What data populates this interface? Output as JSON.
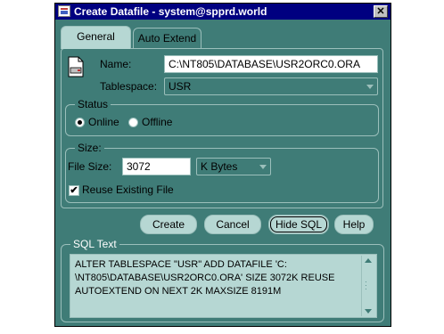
{
  "window": {
    "title": "Create Datafile - system@spprd.world",
    "close_glyph": "✕"
  },
  "tabs": [
    {
      "label": "General",
      "active": true
    },
    {
      "label": "Auto Extend",
      "active": false
    }
  ],
  "general": {
    "name_label": "Name:",
    "name_value": "C:\\NT805\\DATABASE\\USR2ORC0.ORA",
    "tablespace_label": "Tablespace:",
    "tablespace_value": "USR",
    "status_title": "Status",
    "status_options": [
      {
        "label": "Online",
        "selected": true
      },
      {
        "label": "Offline",
        "selected": false
      }
    ],
    "size_title": "Size:",
    "file_size_label": "File Size:",
    "file_size_value": "3072",
    "unit_value": "K Bytes",
    "reuse_label": "Reuse Existing File",
    "reuse_checked": true,
    "check_glyph": "✔"
  },
  "buttons": {
    "create": "Create",
    "cancel": "Cancel",
    "hide_sql": "Hide SQL",
    "help": "Help"
  },
  "sql": {
    "title": "SQL Text",
    "lines": [
      "ALTER TABLESPACE \"USR\" ADD DATAFILE 'C:",
      "\\NT805\\DATABASE\\USR2ORC0.ORA'  SIZE  3072K REUSE",
      "AUTOEXTEND ON NEXT  2K MAXSIZE  8191M"
    ]
  },
  "colors": {
    "window_bg": "#3f7c77",
    "titlebar": "#000080",
    "control_light": "#b6d7d3",
    "border": "#9bbfbb"
  }
}
